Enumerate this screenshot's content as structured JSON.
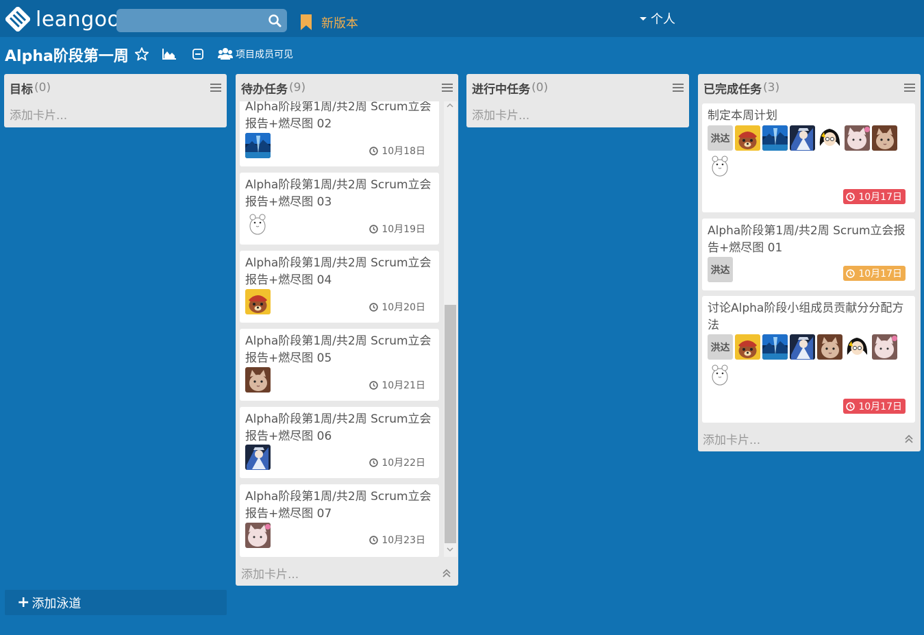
{
  "colors": {
    "topbar": "#0d64a0",
    "background": "#1172b3",
    "accent_orange": "#f0ad4e",
    "due_red": "#e84e58",
    "due_orange": "#f0ad4e"
  },
  "topbar": {
    "logo_text": "leangoo",
    "search_placeholder": "",
    "new_version_label": "新版本",
    "personal_label": "个人"
  },
  "board": {
    "title": "Alpha阶段第一周",
    "visibility_label": "项目成员可见"
  },
  "lanes": [
    {
      "name": "目标",
      "count": "(0)",
      "add_card_label": "添加卡片..."
    },
    {
      "name": "待办任务",
      "count": "(9)",
      "add_card_label": "添加卡片...",
      "cards": [
        {
          "title_line1": "Alpha阶段第1周/共2周 Scrum立会",
          "title_line2": "报告+燃尽图 02",
          "due": "10月18日",
          "avatar": "landscape"
        },
        {
          "title_line1": "Alpha阶段第1周/共2周 Scrum立会",
          "title_line2": "报告+燃尽图 03",
          "due": "10月19日",
          "avatar": "hamster"
        },
        {
          "title_line1": "Alpha阶段第1周/共2周 Scrum立会",
          "title_line2": "报告+燃尽图 04",
          "due": "10月20日",
          "avatar": "bear"
        },
        {
          "title_line1": "Alpha阶段第1周/共2周 Scrum立会",
          "title_line2": "报告+燃尽图 05",
          "due": "10月21日",
          "avatar": "cat"
        },
        {
          "title_line1": "Alpha阶段第1周/共2周 Scrum立会",
          "title_line2": "报告+燃尽图 06",
          "due": "10月22日",
          "avatar": "anime"
        },
        {
          "title_line1": "Alpha阶段第1周/共2周 Scrum立会",
          "title_line2": "报告+燃尽图 07",
          "due": "10月23日",
          "avatar": "kitten"
        }
      ]
    },
    {
      "name": "进行中任务",
      "count": "(0)",
      "add_card_label": "添加卡片..."
    },
    {
      "name": "已完成任务",
      "count": "(3)",
      "add_card_label": "添加卡片...",
      "cards": [
        {
          "title_line1": "制定本周计划",
          "title_line2": "",
          "due": "10月17日",
          "member_label": "洪达",
          "due_color": "red"
        },
        {
          "title_line1": "Alpha阶段第1周/共2周 Scrum立会报",
          "title_line2": "告+燃尽图 01",
          "due": "10月17日",
          "member_label": "洪达",
          "due_color": "orange"
        },
        {
          "title_line1": "讨论Alpha阶段小组成员贡献分分配方",
          "title_line2": "法",
          "due": "10月17日",
          "member_label": "洪达",
          "due_color": "red"
        }
      ]
    }
  ],
  "add_lane_label": "添加泳道"
}
